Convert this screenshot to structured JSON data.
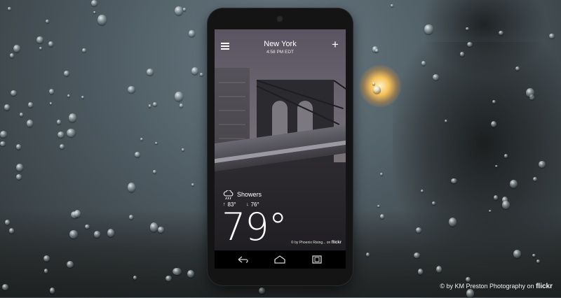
{
  "app": {
    "city": "New York",
    "time": "4:58 PM EDT",
    "condition": "Showers",
    "high": "83°",
    "low": "76°",
    "temperature": "79°",
    "image_credit_prefix": "© by Phoenix Rising...",
    "image_credit_on": "on",
    "image_credit_site": "flickr"
  },
  "toolbar": {
    "menu_icon": "hamburger-menu-icon",
    "add_icon": "plus-icon",
    "add_label": "+"
  },
  "navbar": {
    "back_icon": "back-icon",
    "home_icon": "home-icon",
    "recents_icon": "recents-icon"
  },
  "background": {
    "credit_prefix": "© by KM Preston Photography on",
    "credit_site": "flickr"
  },
  "colors": {
    "text": "#ffffff",
    "navbar": "#000000",
    "phone_body": "#141414"
  }
}
